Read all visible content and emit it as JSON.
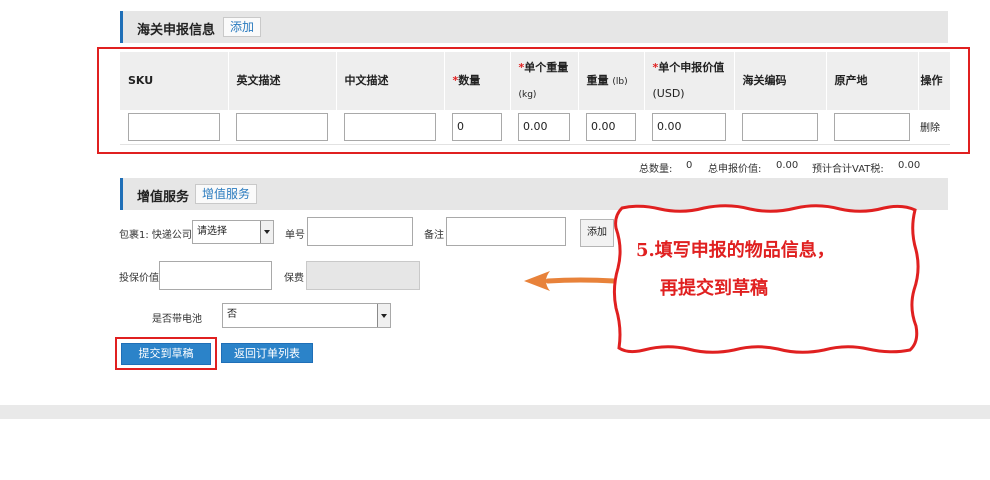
{
  "customs": {
    "title": "海关申报信息",
    "add_label": "添加",
    "columns": [
      {
        "label": "SKU",
        "required": "",
        "unit": ""
      },
      {
        "label": "英文描述",
        "required": "",
        "unit": ""
      },
      {
        "label": "中文描述",
        "required": "",
        "unit": ""
      },
      {
        "label": "数量",
        "required": "*",
        "unit": ""
      },
      {
        "label": "单个重量",
        "required": "*",
        "unit": "(kg)"
      },
      {
        "label": "重量",
        "required": "",
        "unit": "(lb)"
      },
      {
        "label": "单个申报价值",
        "required": "*",
        "unit": "(USD)"
      },
      {
        "label": "海关编码",
        "required": "",
        "unit": ""
      },
      {
        "label": "原产地",
        "required": "",
        "unit": ""
      },
      {
        "label": "操作",
        "required": "",
        "unit": ""
      }
    ],
    "row": {
      "sku": "",
      "en_desc": "",
      "cn_desc": "",
      "quantity": "0",
      "unit_weight": "0.00",
      "weight_lb": "0.00",
      "unit_value": "0.00",
      "hs_code": "",
      "origin": "",
      "delete_label": "删除"
    },
    "totals": {
      "quantity_label": "总数量:",
      "quantity_value": "0",
      "value_label": "总申报价值:",
      "value_value": "0.00",
      "vat_label": "预计合计VAT税:",
      "vat_value": "0.00"
    }
  },
  "value_added": {
    "title": "增值服务",
    "link_label": "增值服务",
    "package_label": "包裹1: 快递公司",
    "courier_select": "请选择",
    "tracking_label": "单号",
    "tracking_value": "",
    "remark_label": "备注",
    "remark_value": "",
    "add_button": "添加",
    "insured_label": "投保价值",
    "insured_value": "",
    "premium_label": "保费",
    "battery_label": "是否带电池",
    "battery_select": "否"
  },
  "actions": {
    "submit_draft": "提交到草稿",
    "back_to_list": "返回订单列表"
  },
  "annotation": {
    "line1": "5.填写申报的物品信息，",
    "line2": "再提交到草稿"
  },
  "colors": {
    "accent_blue": "#2b83c9",
    "header_gray": "#e6e6e6",
    "annotation_red": "#e02020",
    "arrow_orange": "#e8823a",
    "total_orange": "#e66a00"
  }
}
